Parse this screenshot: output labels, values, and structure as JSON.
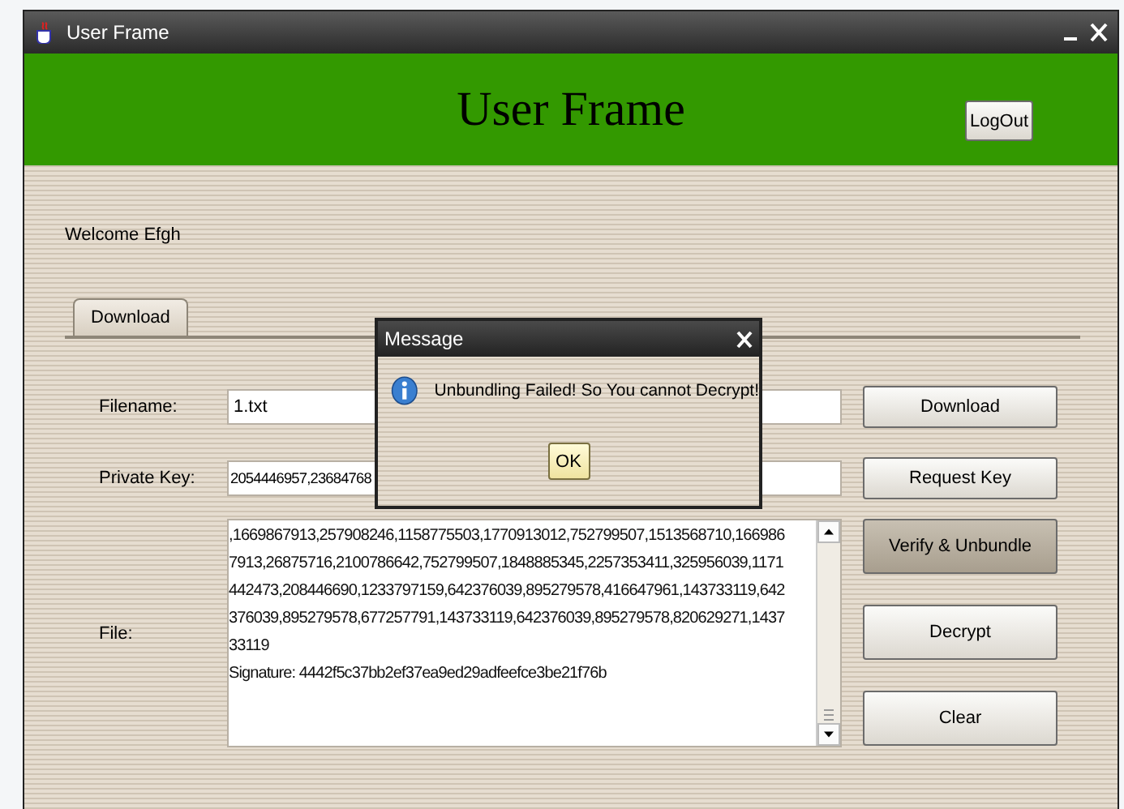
{
  "window": {
    "title": "User Frame"
  },
  "header": {
    "title": "User Frame",
    "logout_button": "LogOut"
  },
  "welcome": "Welcome Efgh",
  "tabs": [
    {
      "label": "Download",
      "selected": true
    }
  ],
  "form": {
    "filename_label": "Filename:",
    "filename_value": "1.txt",
    "private_key_label": "Private Key:",
    "private_key_value": "2054446957,23684768",
    "file_label": "File:",
    "file_lines": [
      ",1669867913,257908246,1158775503,1770913012,752799507,1513568710,166986",
      "7913,26875716,2100786642,752799507,1848885345,2257353411,325956039,1171",
      "442473,208446690,1233797159,642376039,895279578,416647961,143733119,642",
      "376039,895279578,677257791,143733119,642376039,895279578,820629271,1437",
      "33119",
      "Signature: 4442f5c37bb2ef37ea9ed29adfeefce3be21f76b"
    ]
  },
  "buttons": [
    {
      "label": "Download",
      "highlighted": false
    },
    {
      "label": "Request Key",
      "highlighted": false
    },
    {
      "label": "Verify & Unbundle",
      "highlighted": true
    },
    {
      "label": "Decrypt",
      "highlighted": false
    },
    {
      "label": "Clear",
      "highlighted": false
    }
  ],
  "dialog": {
    "title": "Message",
    "message": "Unbundling Failed! So You cannot Decrypt!",
    "ok_button": "OK"
  }
}
